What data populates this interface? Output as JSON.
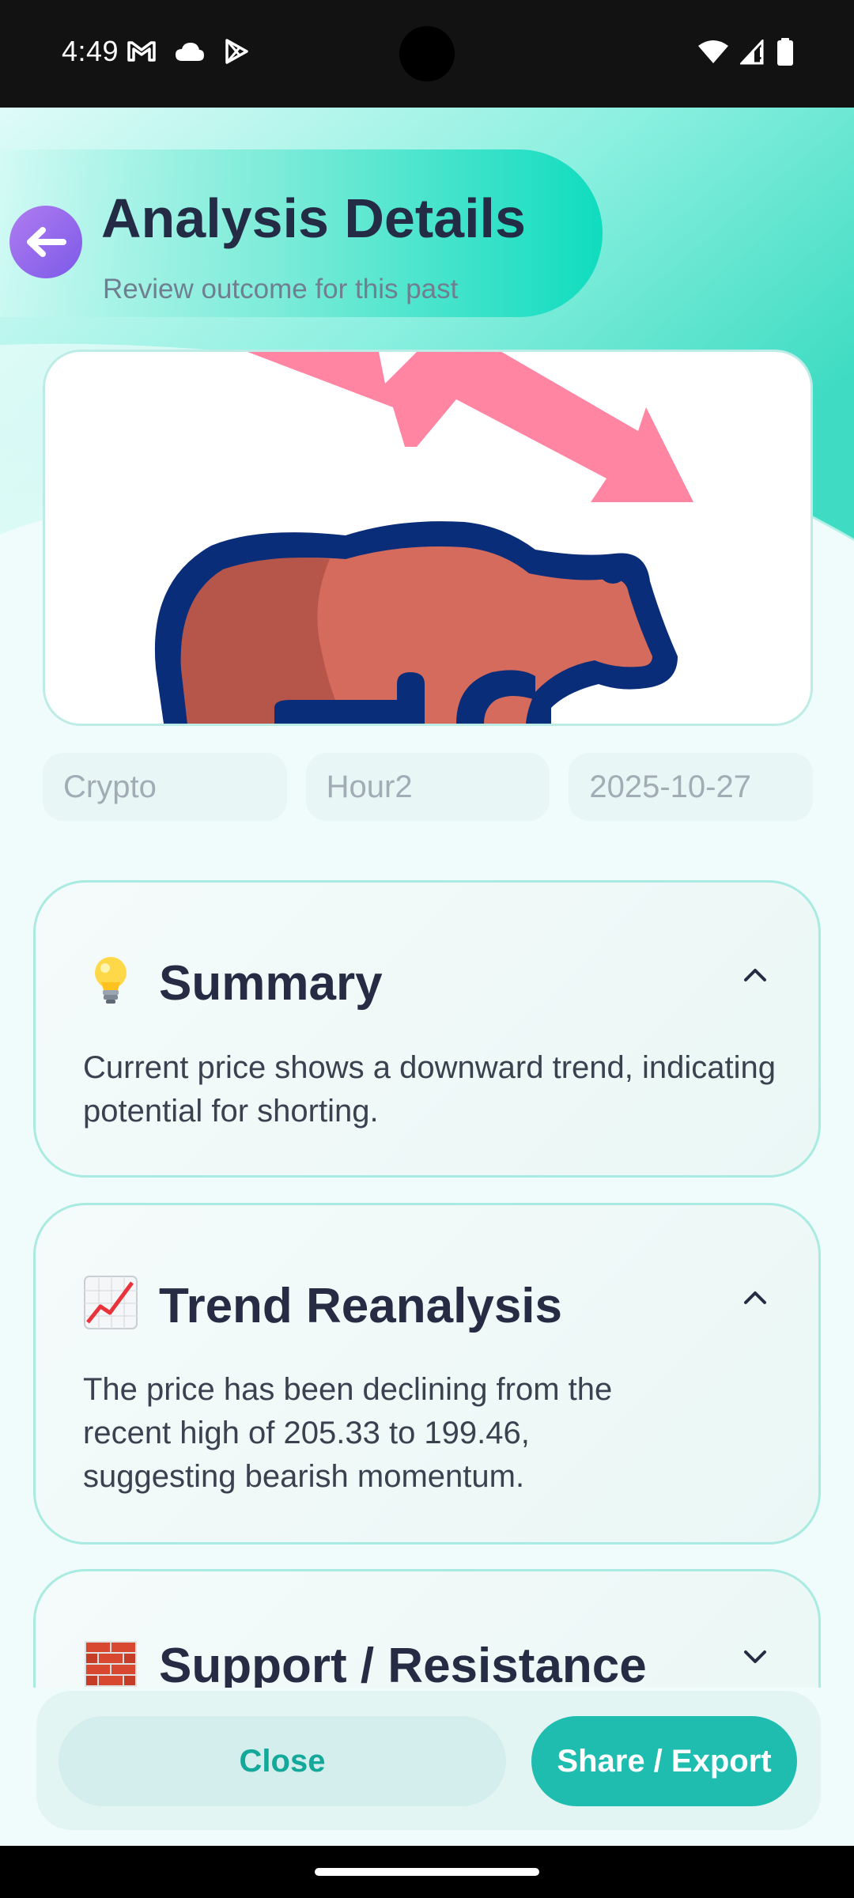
{
  "status_bar": {
    "time": "4:49",
    "left_icons": [
      "gmail-icon",
      "cloud-icon",
      "play-store-icon"
    ],
    "right_icons": [
      "wifi-icon",
      "signal-icon",
      "battery-icon"
    ]
  },
  "header": {
    "title": "Analysis Details",
    "subtitle": "Review outcome for this past",
    "back_icon": "arrow-left-icon"
  },
  "hero_image": {
    "icon": "bear-market-icon",
    "colors": {
      "arrow": "#ff85a2",
      "bear_body": "#d46b5c",
      "bear_shade": "#b65549",
      "outline": "#0a2d7a"
    }
  },
  "chips": [
    "Crypto",
    "Hour2",
    "2025-10-27"
  ],
  "sections": [
    {
      "emoji": "lightbulb-icon",
      "title": "Summary",
      "expanded": true,
      "body": "Current price shows a downward trend, indicating potential for shorting."
    },
    {
      "emoji": "chart-increasing-icon",
      "title": "Trend Reanalysis",
      "expanded": true,
      "body": "The price has been declining from the recent high of 205.33 to 199.46, suggesting bearish momentum."
    },
    {
      "emoji": "brick-icon",
      "title": "Support / Resistance",
      "expanded": false,
      "body": ""
    }
  ],
  "actions": {
    "close_label": "Close",
    "share_label": "Share / Export"
  },
  "colors": {
    "accent": "#1ebdb0",
    "title_text": "#232b45",
    "back_button": "#8a63ec"
  }
}
